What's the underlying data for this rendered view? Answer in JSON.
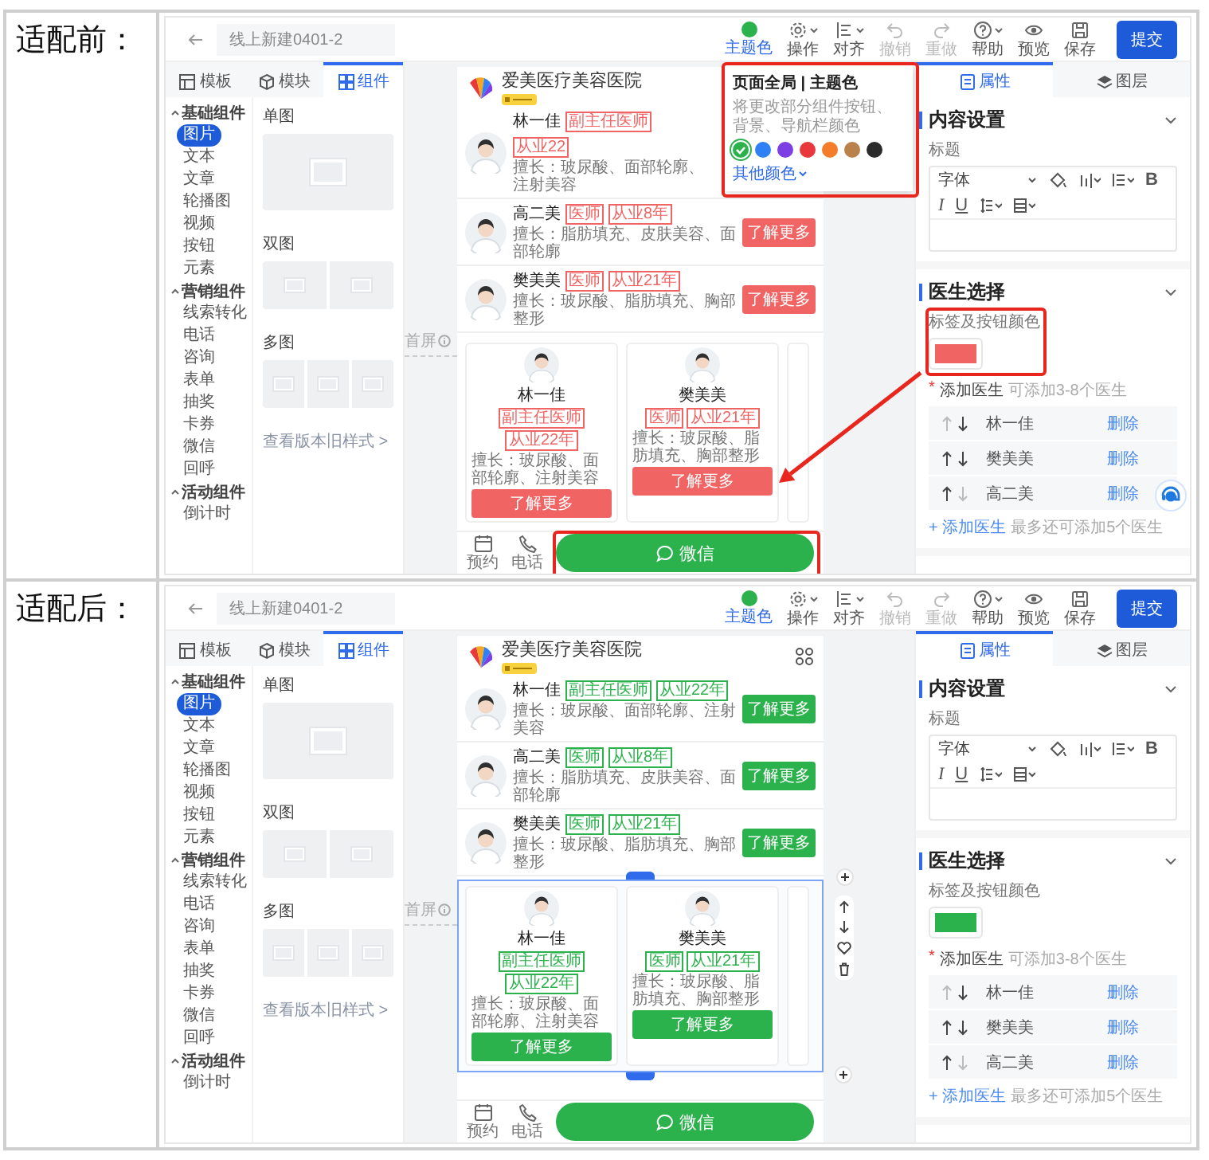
{
  "panels": [
    {
      "label": "适配前：",
      "editor": {
        "title_field": "线上新建0401-2",
        "toolbar": [
          {
            "kind": "theme",
            "label": "主题色",
            "color": "#2bb24c",
            "active": true,
            "disabled": false,
            "dropdown": false
          },
          {
            "kind": "gear",
            "label": "操作",
            "active": false,
            "disabled": false,
            "dropdown": true
          },
          {
            "kind": "align",
            "label": "对齐",
            "active": false,
            "disabled": false,
            "dropdown": true
          },
          {
            "kind": "undo",
            "label": "撤销",
            "active": false,
            "disabled": true,
            "dropdown": false
          },
          {
            "kind": "redo",
            "label": "重做",
            "active": false,
            "disabled": true,
            "dropdown": false
          },
          {
            "kind": "help",
            "label": "帮助",
            "active": false,
            "disabled": false,
            "dropdown": true
          },
          {
            "kind": "eye",
            "label": "预览",
            "active": false,
            "disabled": false,
            "dropdown": false
          },
          {
            "kind": "save",
            "label": "保存",
            "active": false,
            "disabled": false,
            "dropdown": false
          }
        ],
        "submit": "提交",
        "left_tabs": [
          {
            "kind": "template",
            "label": "模板",
            "selected": false
          },
          {
            "kind": "module",
            "label": "模块",
            "selected": false
          },
          {
            "kind": "component",
            "label": "组件",
            "selected": true
          }
        ],
        "categories": [
          {
            "label": "基础组件",
            "expanded": true,
            "children": [
              {
                "label": "图片",
                "selected": true
              },
              {
                "label": "文本",
                "selected": false
              },
              {
                "label": "文章",
                "selected": false
              },
              {
                "label": "轮播图",
                "selected": false
              },
              {
                "label": "视频",
                "selected": false
              },
              {
                "label": "按钮",
                "selected": false
              },
              {
                "label": "元素",
                "selected": false
              }
            ]
          },
          {
            "label": "营销组件",
            "expanded": true,
            "children": [
              {
                "label": "线索转化",
                "selected": false
              },
              {
                "label": "电话",
                "selected": false
              },
              {
                "label": "咨询",
                "selected": false
              },
              {
                "label": "表单",
                "selected": false
              },
              {
                "label": "抽奖",
                "selected": false
              },
              {
                "label": "卡券",
                "selected": false
              },
              {
                "label": "微信",
                "selected": false
              },
              {
                "label": "回呼",
                "selected": false
              }
            ]
          },
          {
            "label": "活动组件",
            "expanded": true,
            "children": [
              {
                "label": "倒计时",
                "selected": false
              }
            ]
          }
        ],
        "previews": [
          {
            "kind": "single",
            "label": "单图"
          },
          {
            "kind": "double",
            "label": "双图"
          },
          {
            "kind": "multi",
            "label": "多图"
          }
        ],
        "old_style_link": "查看版本旧样式 >",
        "first_screen": "首屏",
        "phone": {
          "hospital": "爱美医疗美容医院",
          "doctors": [
            {
              "name": "林一佳",
              "tags": [
                "副主任医师",
                "从业22"
              ],
              "specialty": "擅长：玻尿酸、面部轮廓、注射美容"
            },
            {
              "name": "高二美",
              "tags": [
                "医师",
                "从业8年"
              ],
              "specialty": "擅长：脂肪填充、皮肤美容、面部轮廓",
              "button": "了解更多"
            },
            {
              "name": "樊美美",
              "tags": [
                "医师",
                "从业21年"
              ],
              "specialty": "擅长：玻尿酸、脂肪填充、胸部整形",
              "button": "了解更多"
            }
          ],
          "cards": [
            {
              "name": "林一佳",
              "tags": [
                "副主任医师",
                "从业22年"
              ],
              "specialty": "擅长：玻尿酸、面部轮廓、注射美容",
              "button": "了解更多"
            },
            {
              "name": "樊美美",
              "tags": [
                "医师",
                "从业21年"
              ],
              "specialty": "擅长：玻尿酸、脂肪填充、胸部整形",
              "button": "了解更多"
            }
          ],
          "nav": [
            {
              "kind": "calendar",
              "label": "预约"
            },
            {
              "kind": "phone",
              "label": "电话"
            }
          ],
          "wechat": "微信"
        },
        "theme_popover": {
          "title": "页面全局 | 主题色",
          "desc": "将更改部分组件按钮、背景、导航栏颜色",
          "swatches": [
            {
              "color": "#2bb24c",
              "selected": true
            },
            {
              "color": "#2f80f5",
              "selected": false
            },
            {
              "color": "#7b3fe4",
              "selected": false
            },
            {
              "color": "#e8383b",
              "selected": false
            },
            {
              "color": "#f57c28",
              "selected": false
            },
            {
              "color": "#b9824a",
              "selected": false
            },
            {
              "color": "#2b2b2b",
              "selected": false
            }
          ],
          "more": "其他颜色"
        },
        "annotated": true,
        "chat_float": true,
        "right": {
          "tabs": [
            {
              "kind": "attr",
              "label": "属性",
              "selected": true
            },
            {
              "kind": "layer",
              "label": "图层",
              "selected": false
            }
          ],
          "content": {
            "title": "内容设置",
            "field_label": "标题",
            "toolbar": [
              [
                {
                  "kind": "select",
                  "label": "字体"
                },
                {
                  "kind": "fill"
                },
                {
                  "kind": "size"
                },
                {
                  "kind": "list"
                },
                {
                  "kind": "bold",
                  "label": "B"
                }
              ],
              [
                {
                  "kind": "italic",
                  "label": "I"
                },
                {
                  "kind": "underline",
                  "label": "U"
                },
                {
                  "kind": "spacing"
                },
                {
                  "kind": "block"
                }
              ]
            ]
          },
          "doctors": {
            "title": "医生选择",
            "color_label": "标签及按钮颜色",
            "color": "#f06464",
            "required": "*",
            "add_label": "添加医生",
            "add_hint": "可添加3-8个医生",
            "rows": [
              {
                "name": "林一佳",
                "action": "删除"
              },
              {
                "name": "樊美美",
                "action": "删除"
              },
              {
                "name": "高二美",
                "action": "删除"
              }
            ],
            "footer_link": "+ 添加医生",
            "footer_hint": "最多还可添加5个医生"
          }
        }
      }
    },
    {
      "label": "适配后：",
      "editor": {
        "title_field": "线上新建0401-2",
        "toolbar": [
          {
            "kind": "theme",
            "label": "主题色",
            "color": "#2bb24c",
            "active": true,
            "disabled": false,
            "dropdown": false
          },
          {
            "kind": "gear",
            "label": "操作",
            "active": false,
            "disabled": false,
            "dropdown": true
          },
          {
            "kind": "align",
            "label": "对齐",
            "active": false,
            "disabled": false,
            "dropdown": true
          },
          {
            "kind": "undo",
            "label": "撤销",
            "active": false,
            "disabled": true,
            "dropdown": false
          },
          {
            "kind": "redo",
            "label": "重做",
            "active": false,
            "disabled": true,
            "dropdown": false
          },
          {
            "kind": "help",
            "label": "帮助",
            "active": false,
            "disabled": false,
            "dropdown": true
          },
          {
            "kind": "eye",
            "label": "预览",
            "active": false,
            "disabled": false,
            "dropdown": false
          },
          {
            "kind": "save",
            "label": "保存",
            "active": false,
            "disabled": false,
            "dropdown": false
          }
        ],
        "submit": "提交",
        "left_tabs": [
          {
            "kind": "template",
            "label": "模板",
            "selected": false
          },
          {
            "kind": "module",
            "label": "模块",
            "selected": false
          },
          {
            "kind": "component",
            "label": "组件",
            "selected": true
          }
        ],
        "categories": [
          {
            "label": "基础组件",
            "expanded": true,
            "children": [
              {
                "label": "图片",
                "selected": true
              },
              {
                "label": "文本",
                "selected": false
              },
              {
                "label": "文章",
                "selected": false
              },
              {
                "label": "轮播图",
                "selected": false
              },
              {
                "label": "视频",
                "selected": false
              },
              {
                "label": "按钮",
                "selected": false
              },
              {
                "label": "元素",
                "selected": false
              }
            ]
          },
          {
            "label": "营销组件",
            "expanded": true,
            "children": [
              {
                "label": "线索转化",
                "selected": false
              },
              {
                "label": "电话",
                "selected": false
              },
              {
                "label": "咨询",
                "selected": false
              },
              {
                "label": "表单",
                "selected": false
              },
              {
                "label": "抽奖",
                "selected": false
              },
              {
                "label": "卡券",
                "selected": false
              },
              {
                "label": "微信",
                "selected": false
              },
              {
                "label": "回呼",
                "selected": false
              }
            ]
          },
          {
            "label": "活动组件",
            "expanded": true,
            "children": [
              {
                "label": "倒计时",
                "selected": false
              }
            ]
          }
        ],
        "previews": [
          {
            "kind": "single",
            "label": "单图"
          },
          {
            "kind": "double",
            "label": "双图"
          },
          {
            "kind": "multi",
            "label": "多图"
          }
        ],
        "old_style_link": "查看版本旧样式 >",
        "first_screen": "首屏",
        "phone": {
          "hospital": "爱美医疗美容医院",
          "grid_menu": true,
          "block_selected": true,
          "doctors": [
            {
              "name": "林一佳",
              "tags": [
                "副主任医师",
                "从业22年"
              ],
              "specialty": "擅长：玻尿酸、面部轮廓、注射美容",
              "button": "了解更多"
            },
            {
              "name": "高二美",
              "tags": [
                "医师",
                "从业8年"
              ],
              "specialty": "擅长：脂肪填充、皮肤美容、面部轮廓",
              "button": "了解更多"
            },
            {
              "name": "樊美美",
              "tags": [
                "医师",
                "从业21年"
              ],
              "specialty": "擅长：玻尿酸、脂肪填充、胸部整形",
              "button": "了解更多"
            }
          ],
          "cards": [
            {
              "name": "林一佳",
              "tags": [
                "副主任医师",
                "从业22年"
              ],
              "specialty": "擅长：玻尿酸、面部轮廓、注射美容",
              "button": "了解更多"
            },
            {
              "name": "樊美美",
              "tags": [
                "医师",
                "从业21年"
              ],
              "specialty": "擅长：玻尿酸、脂肪填充、胸部整形",
              "button": "了解更多"
            }
          ],
          "nav": [
            {
              "kind": "calendar",
              "label": "预约"
            },
            {
              "kind": "phone",
              "label": "电话"
            }
          ],
          "wechat": "微信"
        },
        "right": {
          "tabs": [
            {
              "kind": "attr",
              "label": "属性",
              "selected": true
            },
            {
              "kind": "layer",
              "label": "图层",
              "selected": false
            }
          ],
          "content": {
            "title": "内容设置",
            "field_label": "标题",
            "toolbar": [
              [
                {
                  "kind": "select",
                  "label": "字体"
                },
                {
                  "kind": "fill"
                },
                {
                  "kind": "size"
                },
                {
                  "kind": "list"
                },
                {
                  "kind": "bold",
                  "label": "B"
                }
              ],
              [
                {
                  "kind": "italic",
                  "label": "I"
                },
                {
                  "kind": "underline",
                  "label": "U"
                },
                {
                  "kind": "spacing"
                },
                {
                  "kind": "block"
                }
              ]
            ]
          },
          "doctors": {
            "title": "医生选择",
            "color_label": "标签及按钮颜色",
            "color": "#2bb24c",
            "required": "*",
            "add_label": "添加医生",
            "add_hint": "可添加3-8个医生",
            "rows": [
              {
                "name": "林一佳",
                "action": "删除"
              },
              {
                "name": "樊美美",
                "action": "删除"
              },
              {
                "name": "高二美",
                "action": "删除"
              }
            ],
            "footer_link": "+ 添加医生",
            "footer_hint": "最多还可添加5个医生"
          }
        }
      }
    }
  ]
}
